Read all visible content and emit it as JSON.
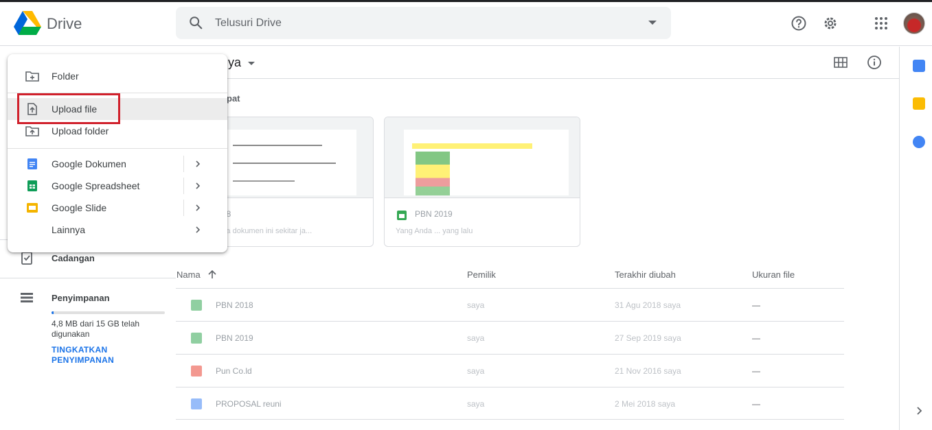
{
  "app": {
    "name": "Drive"
  },
  "search": {
    "placeholder": "Telusuri Drive"
  },
  "main": {
    "title_fragment": "ya",
    "section_fragment": "pat",
    "columns": {
      "name": "Nama",
      "owner": "Pemilik",
      "modified": "Terakhir diubah",
      "size": "Ukuran file"
    },
    "cards": [
      {
        "title": "... 018",
        "subtitle": "... membuka dokumen ini sekitar ja..."
      },
      {
        "title": "PBN 2019",
        "subtitle": "Yang Anda ... yang lalu"
      }
    ],
    "files": [
      {
        "name": "PBN 2018",
        "owner": "saya",
        "modified": "31 Agu 2018 saya",
        "size": "—",
        "color": "#34a853"
      },
      {
        "name": "PBN 2019",
        "owner": "saya",
        "modified": "27 Sep 2019 saya",
        "size": "—",
        "color": "#34a853"
      },
      {
        "name": "Pun Co.ld",
        "owner": "saya",
        "modified": "21 Nov 2016 saya",
        "size": "—",
        "color": "#ea4335"
      },
      {
        "name": "PROPOSAL reuni",
        "owner": "saya",
        "modified": "2 Mei 2018 saya",
        "size": "—",
        "color": "#4285f4"
      }
    ]
  },
  "sidebar": {
    "backup": "Cadangan",
    "storage": "Penyimpanan",
    "storage_usage": "4,8 MB dari 15 GB telah digunakan",
    "storage_fraction": 0.02,
    "upgrade": "TINGKATKAN PENYIMPANAN"
  },
  "menu": {
    "folder": "Folder",
    "upload_file": "Upload file",
    "upload_folder": "Upload folder",
    "docs": "Google Dokumen",
    "sheets": "Google Spreadsheet",
    "slides": "Google Slide",
    "more": "Lainnya"
  },
  "colors": {
    "highlight": "#d0202b",
    "accent": "#1a73e8"
  }
}
